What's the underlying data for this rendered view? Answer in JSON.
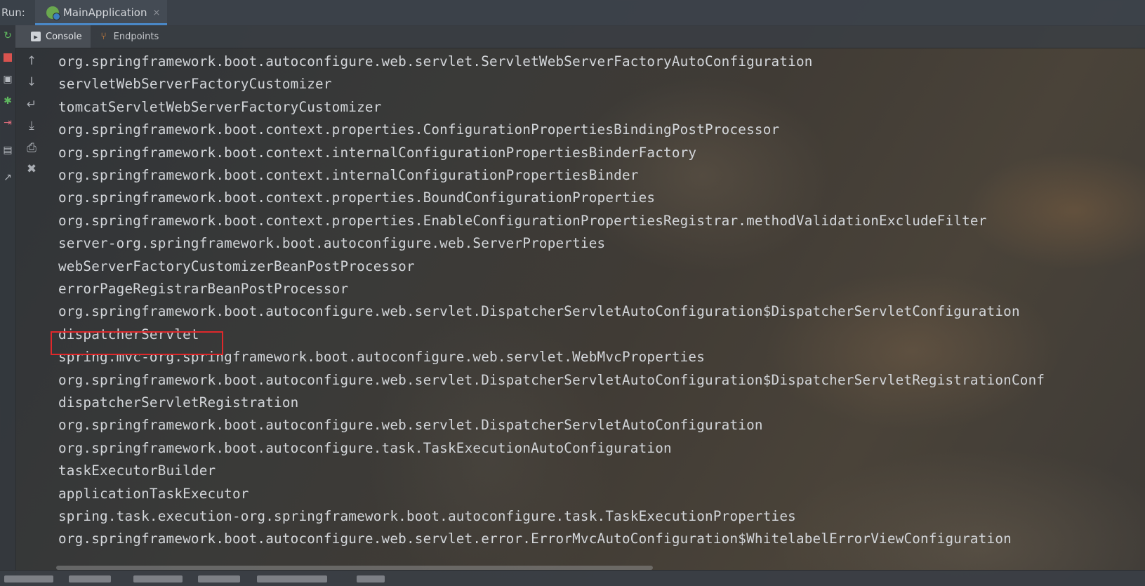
{
  "run_bar": {
    "label": "Run:",
    "tab_label": "MainApplication",
    "close_glyph": "×"
  },
  "sub_tabs": [
    {
      "label": "Console",
      "icon": "console-icon",
      "active": true
    },
    {
      "label": "Endpoints",
      "icon": "endpoints-icon",
      "active": false
    }
  ],
  "left_toolbar_icons": [
    "rerun-icon",
    "stop-icon",
    "camera-icon",
    "debug-bug-icon",
    "login-icon",
    "layout-icon",
    "pin-icon"
  ],
  "console_actions": [
    "arrow-up-icon",
    "arrow-down-icon",
    "soft-wrap-icon",
    "scroll-to-end-icon",
    "print-icon",
    "trash-icon"
  ],
  "highlight_color": "#e0282b",
  "console": {
    "lines": [
      "org.springframework.boot.autoconfigure.web.servlet.ServletWebServerFactoryAutoConfiguration",
      "servletWebServerFactoryCustomizer",
      "tomcatServletWebServerFactoryCustomizer",
      "org.springframework.boot.context.properties.ConfigurationPropertiesBindingPostProcessor",
      "org.springframework.boot.context.internalConfigurationPropertiesBinderFactory",
      "org.springframework.boot.context.internalConfigurationPropertiesBinder",
      "org.springframework.boot.context.properties.BoundConfigurationProperties",
      "org.springframework.boot.context.properties.EnableConfigurationPropertiesRegistrar.methodValidationExcludeFilter",
      "server-org.springframework.boot.autoconfigure.web.ServerProperties",
      "webServerFactoryCustomizerBeanPostProcessor",
      "errorPageRegistrarBeanPostProcessor",
      "org.springframework.boot.autoconfigure.web.servlet.DispatcherServletAutoConfiguration$DispatcherServletConfiguration",
      "dispatcherServlet",
      "spring.mvc-org.springframework.boot.autoconfigure.web.servlet.WebMvcProperties",
      "org.springframework.boot.autoconfigure.web.servlet.DispatcherServletAutoConfiguration$DispatcherServletRegistrationConf",
      "dispatcherServletRegistration",
      "org.springframework.boot.autoconfigure.web.servlet.DispatcherServletAutoConfiguration",
      "org.springframework.boot.autoconfigure.task.TaskExecutionAutoConfiguration",
      "taskExecutorBuilder",
      "applicationTaskExecutor",
      "spring.task.execution-org.springframework.boot.autoconfigure.task.TaskExecutionProperties",
      "org.springframework.boot.autoconfigure.web.servlet.error.ErrorMvcAutoConfiguration$WhitelabelErrorViewConfiguration"
    ]
  }
}
